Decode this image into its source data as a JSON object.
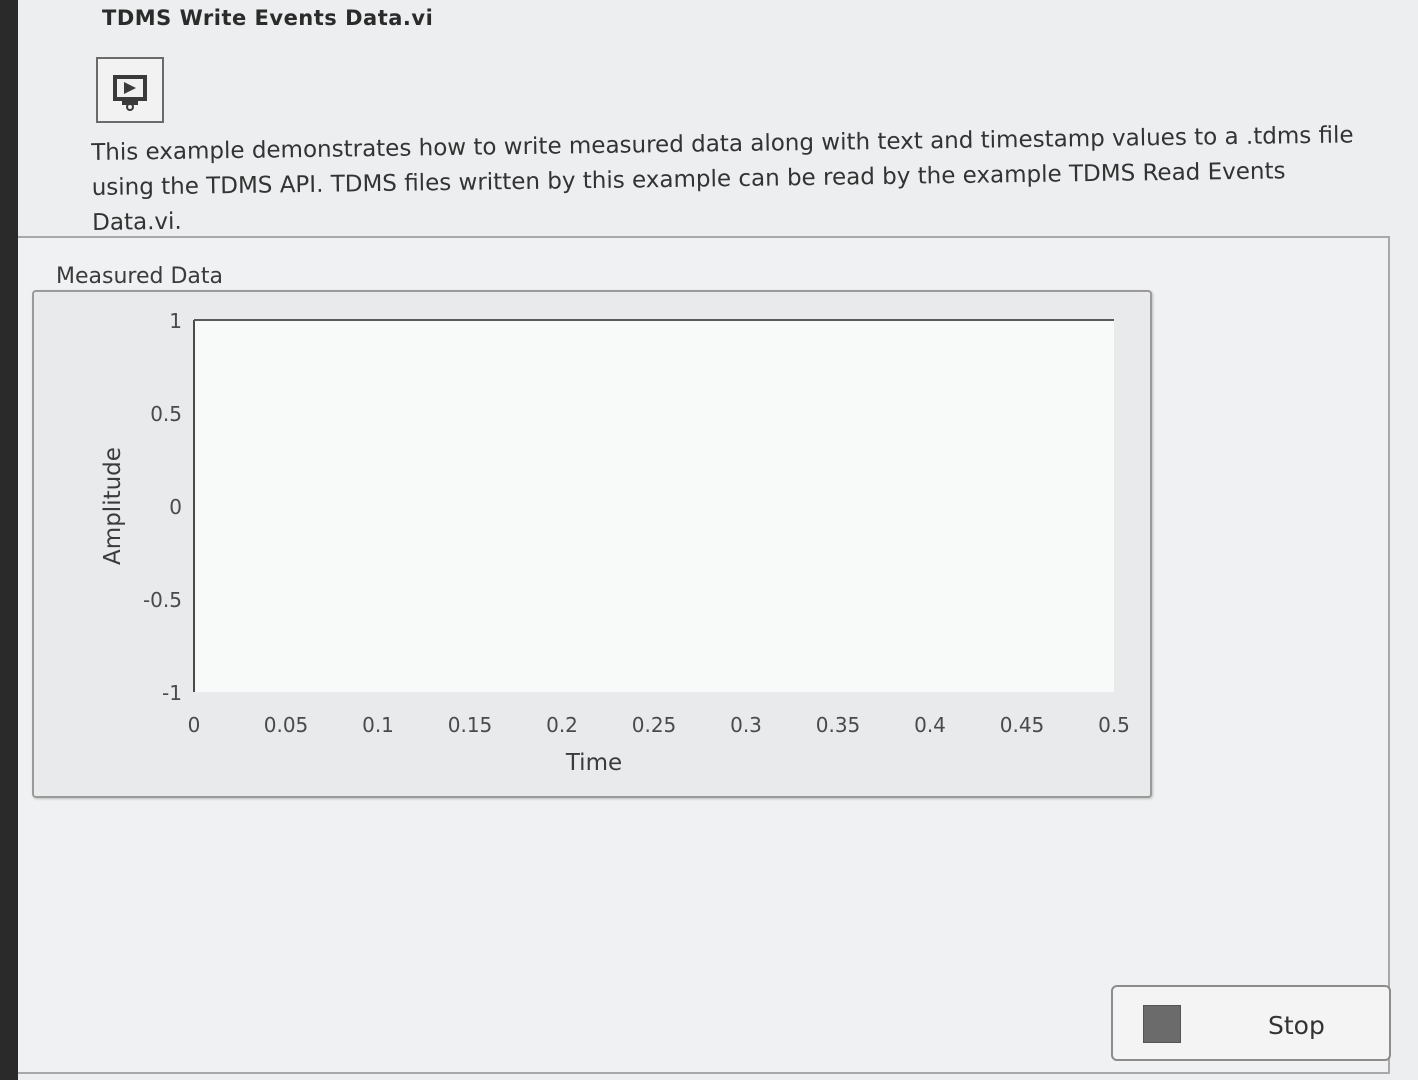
{
  "vi": {
    "title": "TDMS Write Events Data.vi",
    "icon": "vi-icon"
  },
  "description": "This example demonstrates how to write measured data along with text and timestamp values to a .tdms file using the TDMS API. TDMS files written by this example can be read by the example TDMS Read Events Data.vi.",
  "graph": {
    "label": "Measured Data"
  },
  "chart_data": {
    "type": "line",
    "title": "Measured Data",
    "xlabel": "Time",
    "ylabel": "Amplitude",
    "xlim": [
      0,
      0.5
    ],
    "ylim": [
      -1,
      1
    ],
    "x_ticks": [
      "0",
      "0.05",
      "0.1",
      "0.15",
      "0.2",
      "0.25",
      "0.3",
      "0.35",
      "0.4",
      "0.45",
      "0.5"
    ],
    "y_ticks": [
      "1",
      "0.5",
      "0",
      "-0.5",
      "-1"
    ],
    "grid": false,
    "series": [
      {
        "x": [
          0,
          0.5
        ],
        "y": [
          1,
          1
        ]
      }
    ],
    "colors": {
      "plot_background": "#f8f9f9",
      "line": "#5a5a5a"
    }
  },
  "stop_button": {
    "label": "Stop",
    "led_icon": "stop-led-indicator"
  }
}
